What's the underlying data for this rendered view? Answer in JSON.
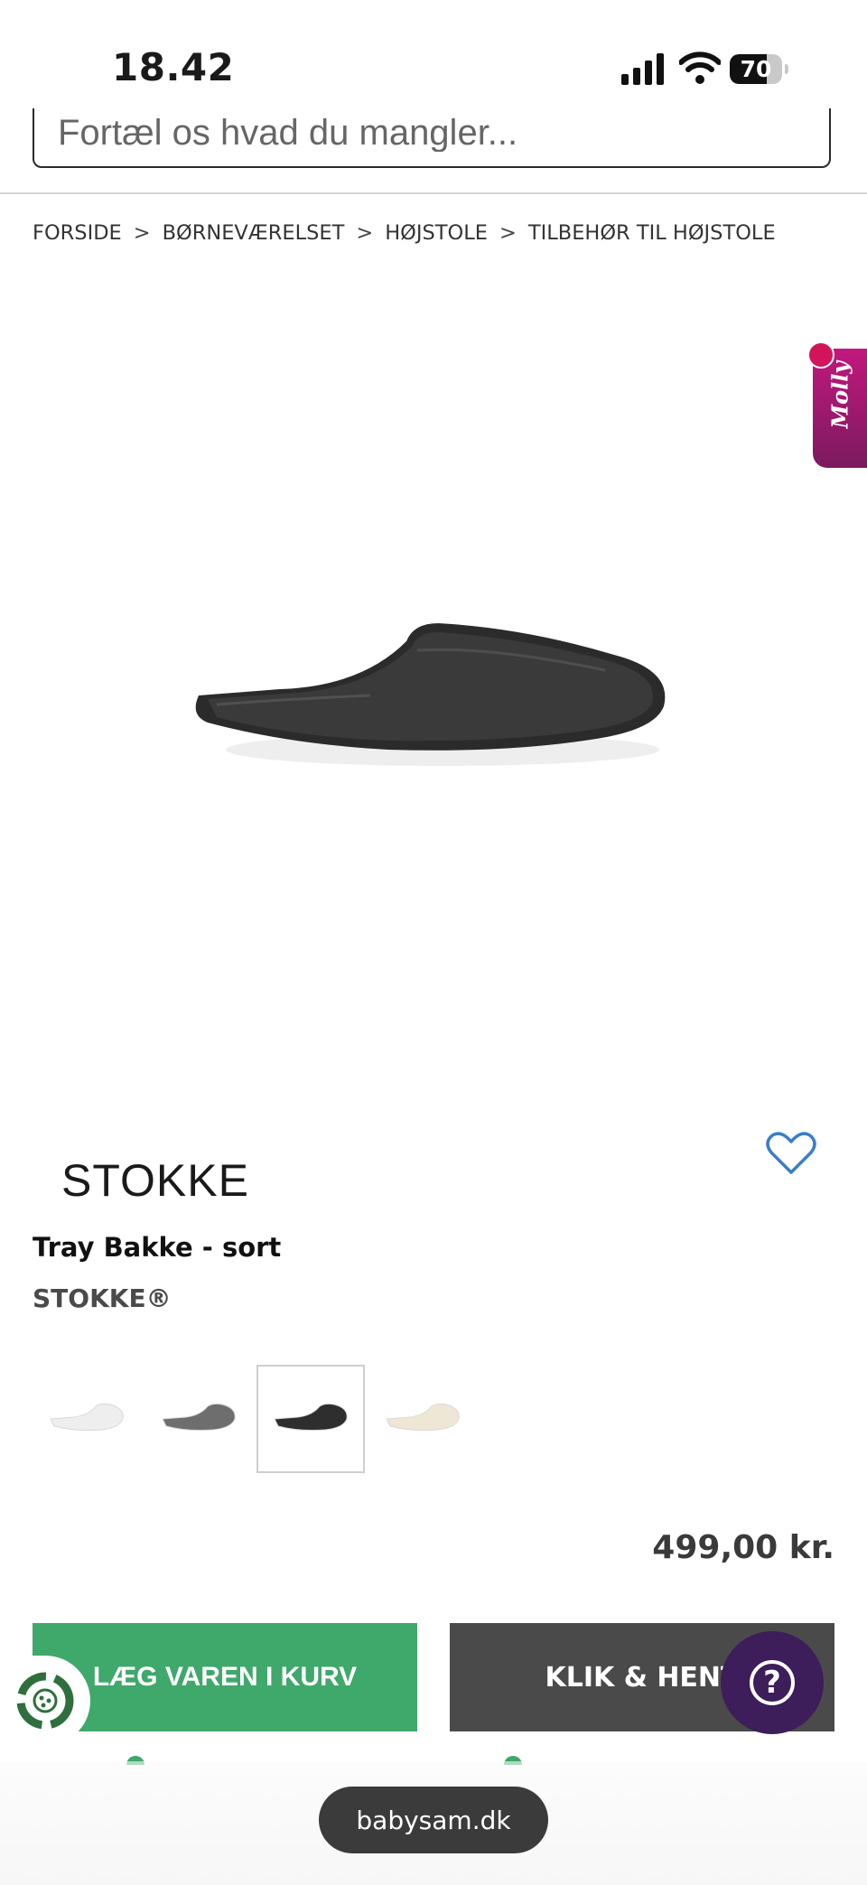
{
  "status_bar": {
    "time": "18.42",
    "battery": "70",
    "battery_level": 0.7
  },
  "search": {
    "placeholder": "Fortæl os hvad du mangler..."
  },
  "breadcrumb": [
    {
      "label": "FORSIDE"
    },
    {
      "label": "BØRNEVÆRELSET"
    },
    {
      "label": "HØJSTOLE"
    },
    {
      "label": "TILBEHØR TIL HØJSTOLE"
    }
  ],
  "breadcrumb_separator": ">",
  "assistant": {
    "label": "Molly"
  },
  "product": {
    "brand_logo": "STOKKE",
    "title": "Tray Bakke - sort",
    "brand": "STOKKE®",
    "price": "499,00 kr.",
    "variants": [
      {
        "color": "#eeeeee",
        "icon": "white-tray"
      },
      {
        "color": "#6e6e6e",
        "icon": "grey-tray"
      },
      {
        "color": "#2e2e2e",
        "icon": "black-tray",
        "selected": true
      },
      {
        "color": "#efe7d6",
        "icon": "cream-tray"
      }
    ]
  },
  "actions": {
    "add_to_cart": "LÆG VAREN I KURV",
    "click_collect": "KLIK & HENT"
  },
  "help": {
    "icon": "?"
  },
  "browser": {
    "url": "babysam.dk"
  },
  "colors": {
    "accent_green": "#3fa86b",
    "dark_button": "#4a4a4a",
    "help_purple": "#3d1d5a",
    "molly_pink": "#c2187e",
    "heart_blue": "#3a7ec6"
  }
}
